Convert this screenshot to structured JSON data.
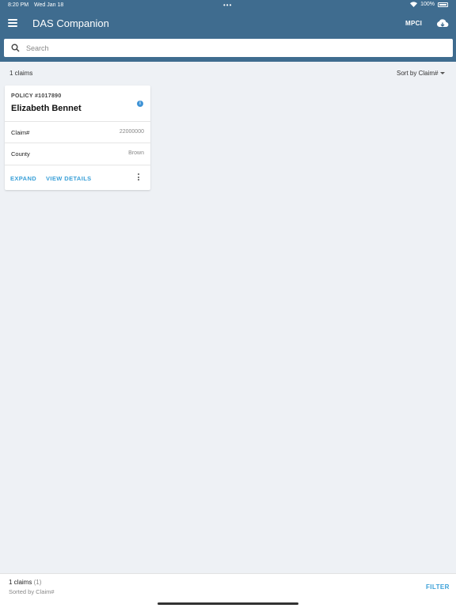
{
  "status_bar": {
    "time": "8:20 PM",
    "date": "Wed Jan 18",
    "dots": "•••",
    "battery_percent": "100%"
  },
  "app_bar": {
    "title": "DAS Companion",
    "program_label": "MPCI",
    "background_color": "#3f6c8f"
  },
  "search": {
    "placeholder": "Search",
    "value": ""
  },
  "list_header": {
    "count_text": "1 claims",
    "sort_label": "Sort by Claim#"
  },
  "card": {
    "policy_label": "POLICY #1017890",
    "insured_name": "Elizabeth Bennet",
    "info_icon_glyph": "i",
    "rows": [
      {
        "label": "Claim#",
        "value": "22000000"
      },
      {
        "label": "County",
        "value": "Brown"
      }
    ],
    "actions": {
      "expand_label": "EXPAND",
      "details_label": "VIEW DETAILS"
    }
  },
  "footer": {
    "count_text": "1 claims",
    "count_sub": "(1)",
    "sorted_text": "Sorted by Claim#",
    "filter_label": "FILTER"
  },
  "colors": {
    "accent": "#3aa0d8",
    "header": "#3f6c8f",
    "background": "#eef1f5"
  }
}
